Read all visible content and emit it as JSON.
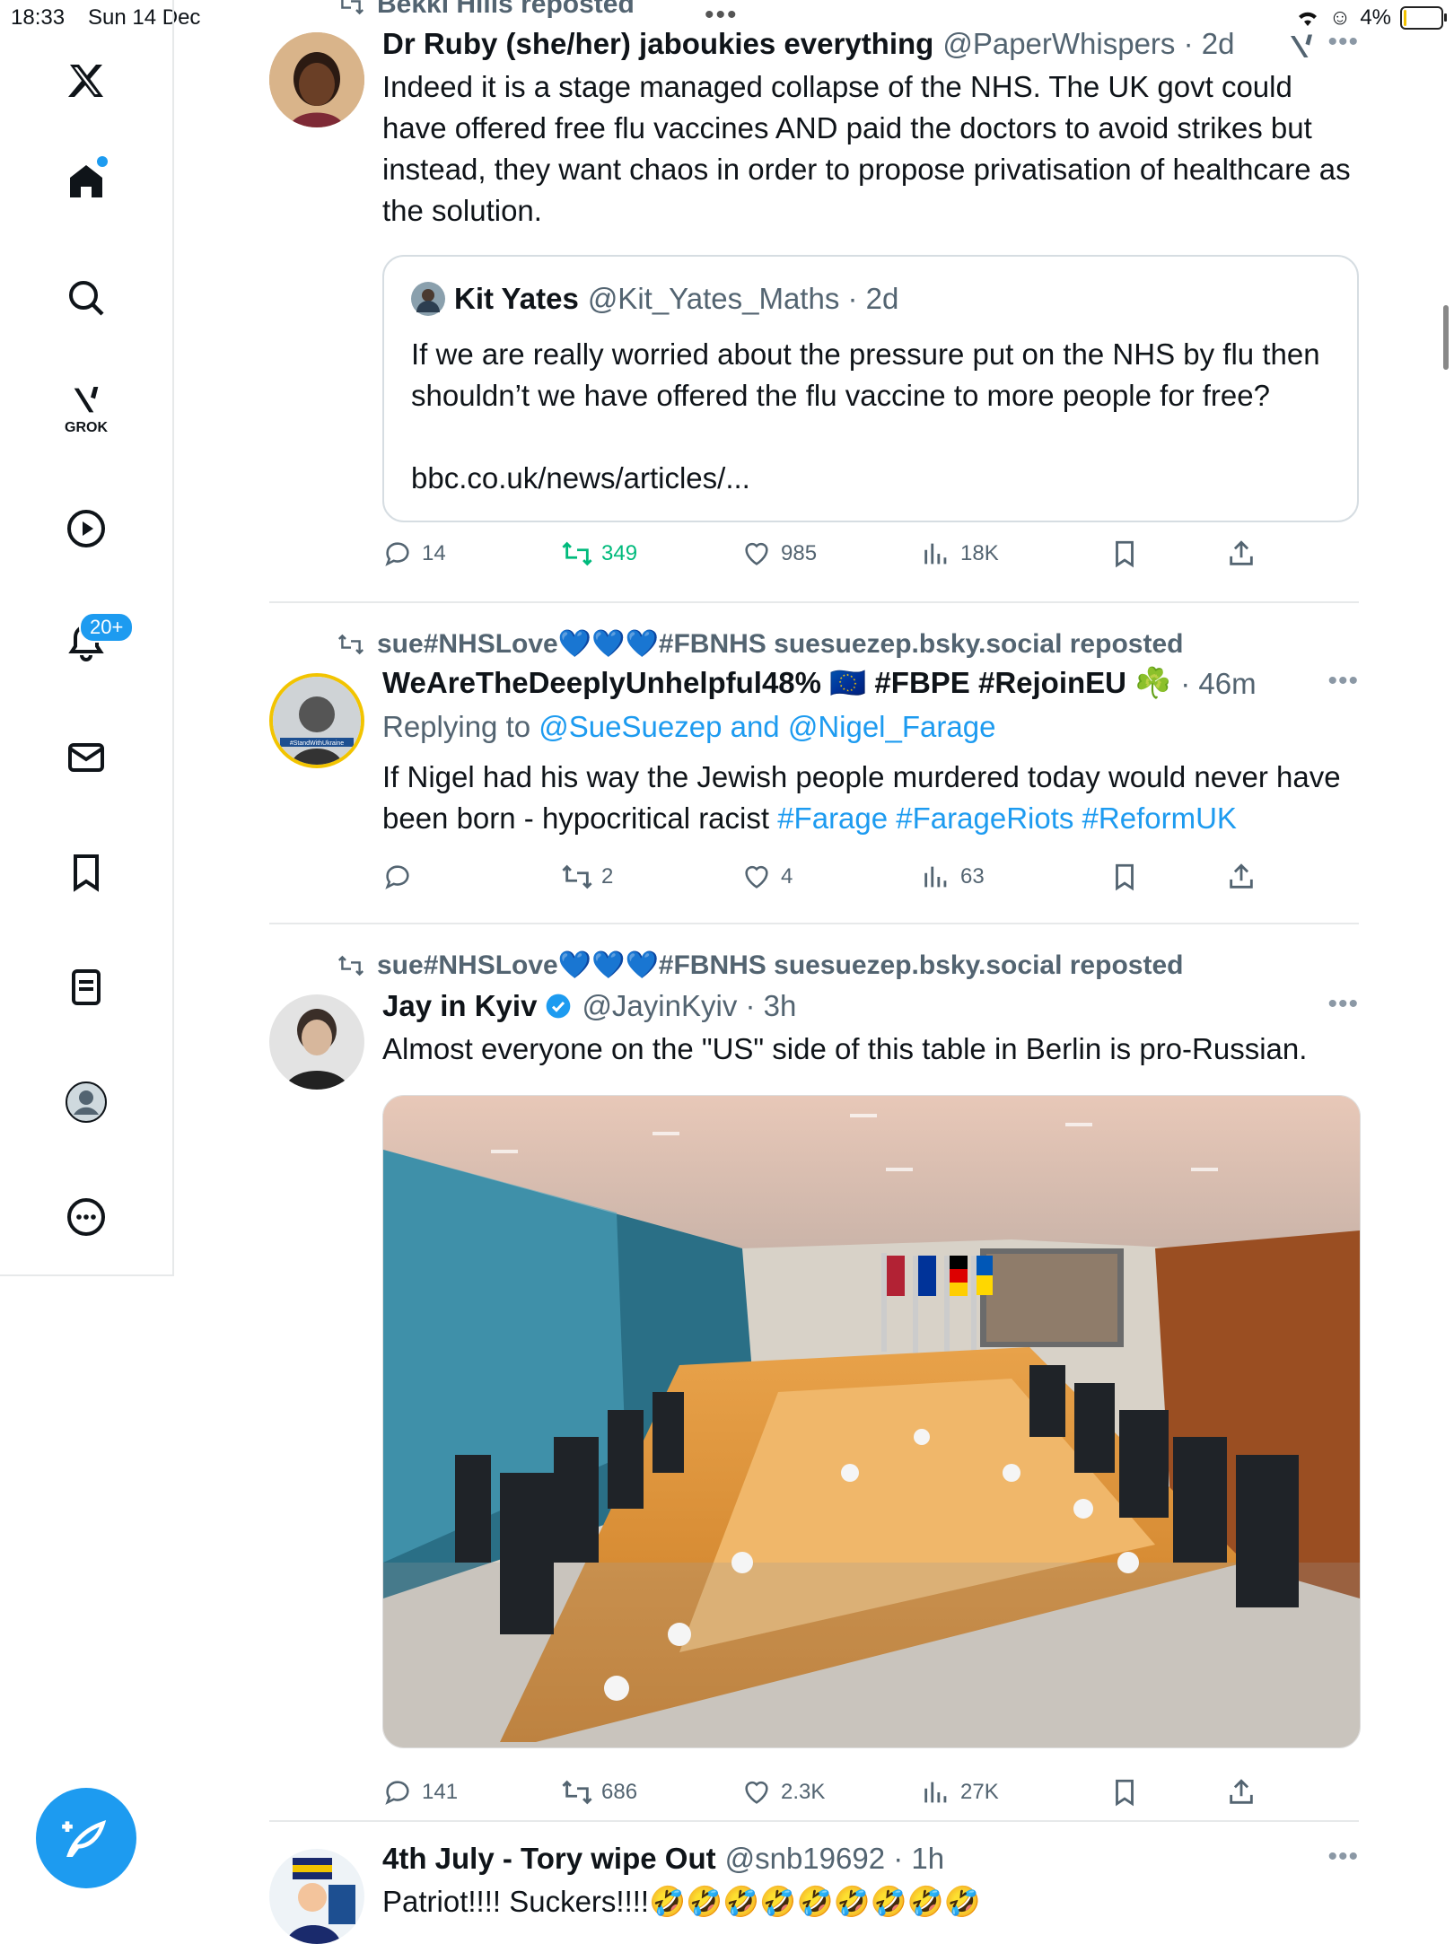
{
  "status": {
    "time": "18:33",
    "date": "Sun 14 Dec",
    "battery": "4%",
    "battery_level": 0.04
  },
  "sidebar": {
    "grok_label": "GROK",
    "notifications_badge": "20+"
  },
  "tweets": [
    {
      "repost_by": "Bekki Hills reposted",
      "name": "Dr Ruby (she/her) jaboukies everything",
      "handle": "@PaperWhispers · 2d",
      "text": "Indeed it is a stage managed collapse of the NHS. The UK govt could have offered free flu vaccines AND paid the doctors to avoid strikes but instead, they want chaos in order to propose privatisation of healthcare as the solution.",
      "quote": {
        "name": "Kit Yates",
        "handle": "@Kit_Yates_Maths · 2d",
        "text": "If we are really worried about the pressure put on the NHS by flu then shouldn’t we have offered the flu vaccine to more people for free?",
        "link": "bbc.co.uk/news/articles/..."
      },
      "replies": "14",
      "reposts": "349",
      "likes": "985",
      "views": "18K"
    },
    {
      "repost_by": "sue#NHSLove💙💙💙#FBNHS suesuezep.bsky.social reposted",
      "name": "WeAreTheDeeplyUnhelpful48% 🇪🇺 #FBPE #RejoinEU ☘️",
      "handle": "· 46m",
      "replying_label": "Replying to",
      "replying_to": "@SueSuezep and @Nigel_Farage",
      "text": "If Nigel had his way the Jewish people murdered today would never have been born - hypocritical racist",
      "hashtags": "#Farage #FarageRiots #ReformUK",
      "avatar_text": "#StandWithUkraine",
      "replies": "",
      "reposts": "2",
      "likes": "4",
      "views": "63"
    },
    {
      "repost_by": "sue#NHSLove💙💙💙#FBNHS suesuezep.bsky.social reposted",
      "name": "Jay in Kyiv",
      "handle": "@JayinKyiv · 3h",
      "text": "Almost everyone on the \"US\" side of this table in Berlin is pro-Russian.",
      "replies": "141",
      "reposts": "686",
      "likes": "2.3K",
      "views": "27K"
    },
    {
      "name": "4th July - Tory wipe Out",
      "handle": "@snb19692 · 1h",
      "text": "Patriot!!!! Suckers!!!!🤣🤣🤣🤣🤣🤣🤣🤣🤣"
    }
  ]
}
